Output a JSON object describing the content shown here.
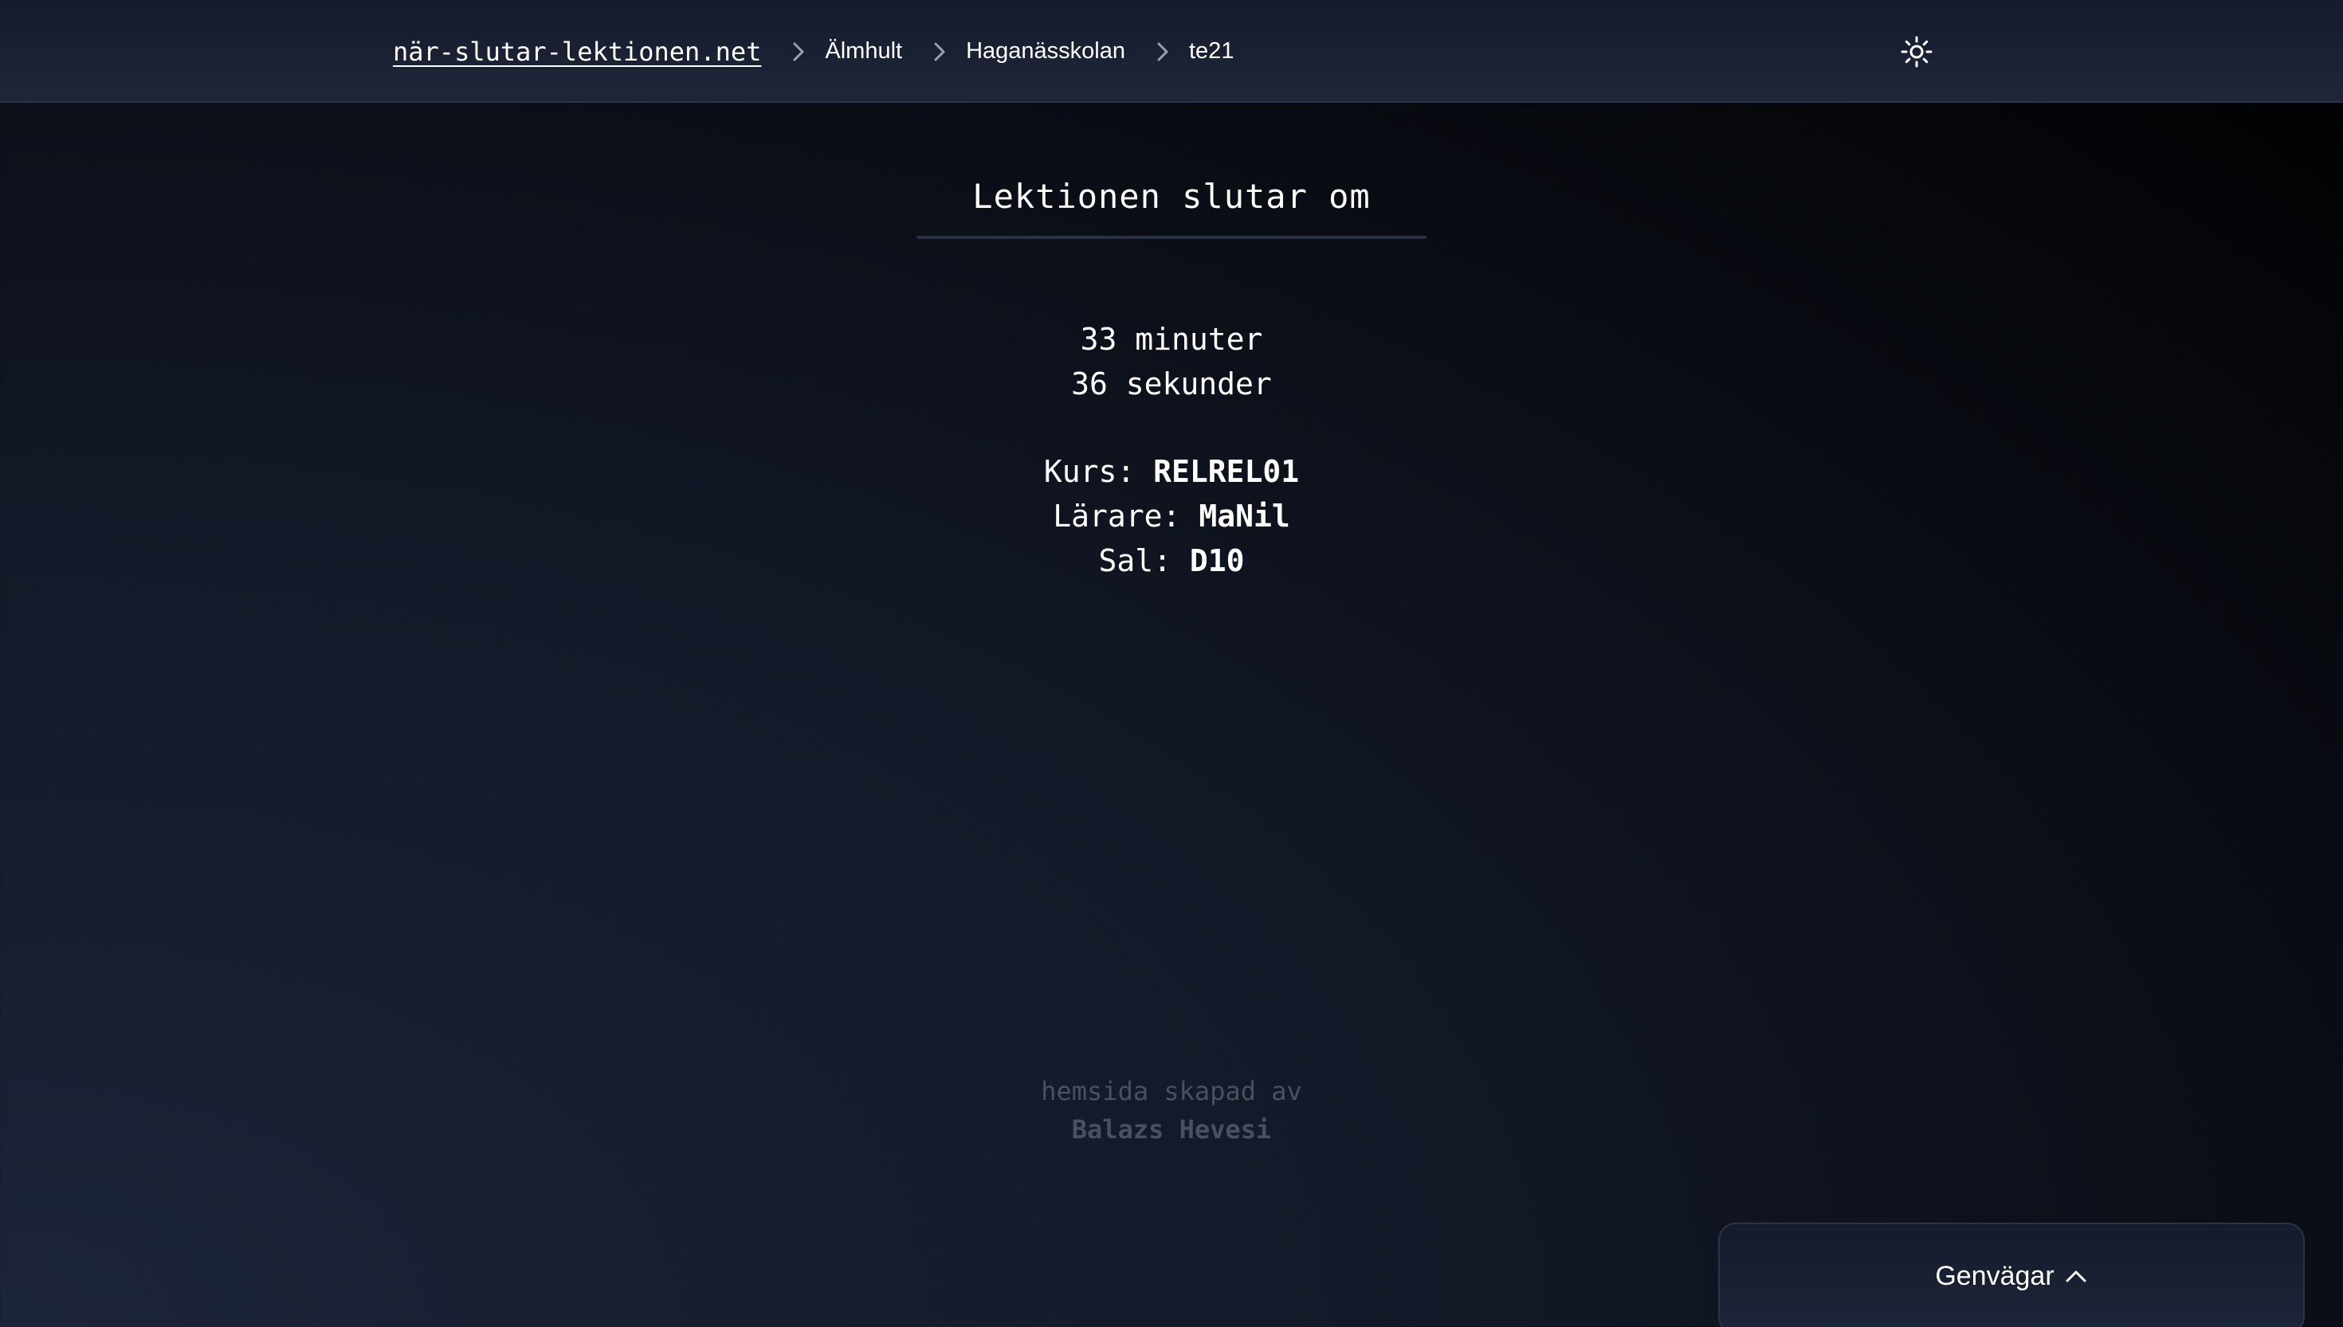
{
  "header": {
    "home_link": "när-slutar-lektionen.net",
    "breadcrumbs": [
      {
        "label": "Älmhult"
      },
      {
        "label": "Haganässkolan"
      },
      {
        "label": "te21"
      }
    ],
    "theme_icon": "sun-icon"
  },
  "main": {
    "title": "Lektionen slutar om",
    "countdown": {
      "minutes": "33 minuter",
      "seconds": "36 sekunder"
    },
    "info": {
      "course_label": "Kurs:",
      "course_value": "RELREL01",
      "teacher_label": "Lärare:",
      "teacher_value": "MaNil",
      "room_label": "Sal:",
      "room_value": "D10"
    }
  },
  "footer": {
    "credit_line": "hemsida skapad av",
    "author": "Balazs Hevesi"
  },
  "shortcuts": {
    "label": "Genvägar",
    "icon": "chevron-up-icon"
  },
  "colors": {
    "text": "#ffffff",
    "muted": "#4a5060",
    "header_bg": "#1a2133",
    "divider": "#2a3142"
  }
}
